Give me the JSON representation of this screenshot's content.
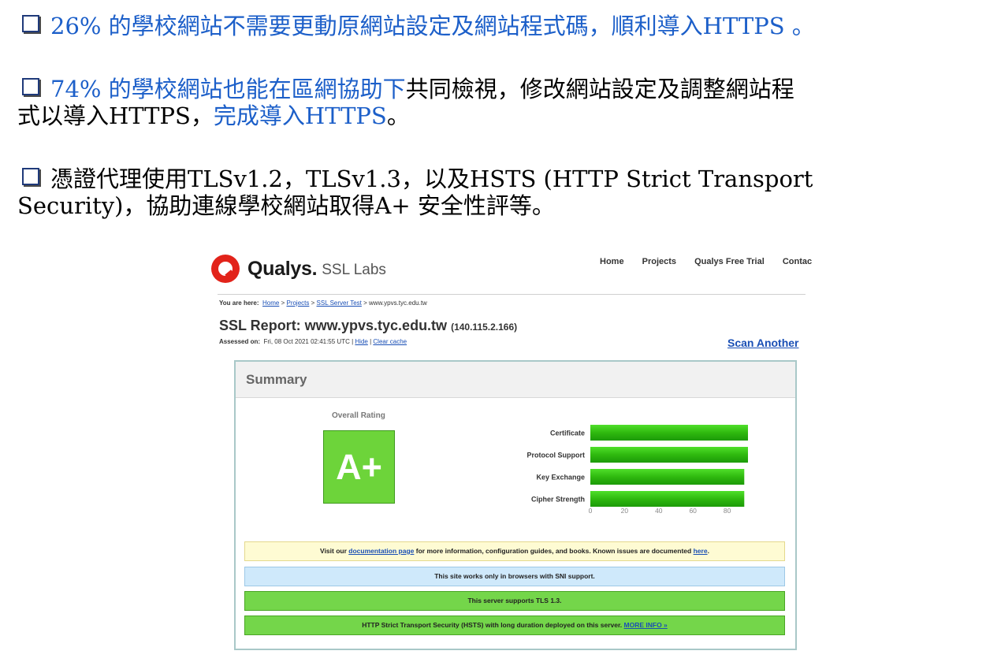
{
  "bullets": [
    {
      "blue": "26% 的學校網站不需要更動原網站設定及網站程式碼，順利導入HTTPS 。"
    },
    {
      "line1_blue": "74% 的學校網站也能在區網協助下",
      "line1_black": "共同檢視，修改網站設定及調整網站程",
      "line2_black": "式以導入HTTPS，",
      "line2_blue": "完成導入HTTPS",
      "line2_end": "。"
    },
    {
      "line1": "憑證代理使用TLSv1.2，TLSv1.3，以及HSTS (HTTP Strict Transport",
      "line2": "Security)，協助連線學校網站取得A+ 安全性評等。"
    }
  ],
  "qualys": {
    "logo": "Qualys.",
    "logo_sub": "SSL Labs",
    "nav": [
      "Home",
      "Projects",
      "Qualys Free Trial",
      "Contac"
    ],
    "breadcrumb": {
      "prefix": "You are here:",
      "home": "Home",
      "sep1": ">",
      "projects": "Projects",
      "sep2": ">",
      "test": "SSL Server Test",
      "rest": "> www.ypvs.tyc.edu.tw"
    },
    "report_title": "SSL Report: www.ypvs.tyc.edu.tw",
    "report_ip": "(140.115.2.166)",
    "assessed_label": "Assessed on:",
    "assessed_value": "Fri, 08 Oct 2021 02:41:55 UTC |",
    "hide": "Hide",
    "pipe": "|",
    "clear_cache": "Clear cache",
    "scan_another": "Scan Another",
    "summary_title": "Summary",
    "overall_rating": "Overall Rating",
    "grade": "A+",
    "banners": {
      "b1_pre": "Visit our ",
      "b1_link1": "documentation page",
      "b1_mid": " for more information, configuration guides, and books. Known issues are documented ",
      "b1_link2": "here",
      "b1_end": ".",
      "b2": "This site works only in browsers with SNI support.",
      "b3": "This server supports TLS 1.3.",
      "b4_pre": "HTTP Strict Transport Security (HSTS) with long duration deployed on this server.  ",
      "b4_link": "MORE INFO »"
    }
  },
  "chart_data": {
    "type": "bar",
    "orientation": "horizontal",
    "categories": [
      "Certificate",
      "Protocol Support",
      "Key Exchange",
      "Cipher Strength"
    ],
    "values": [
      100,
      100,
      90,
      90
    ],
    "xlim": [
      0,
      100
    ],
    "xticks": [
      0,
      20,
      40,
      60,
      80,
      100
    ],
    "bar_color": "#2fb90f",
    "grid": false
  }
}
